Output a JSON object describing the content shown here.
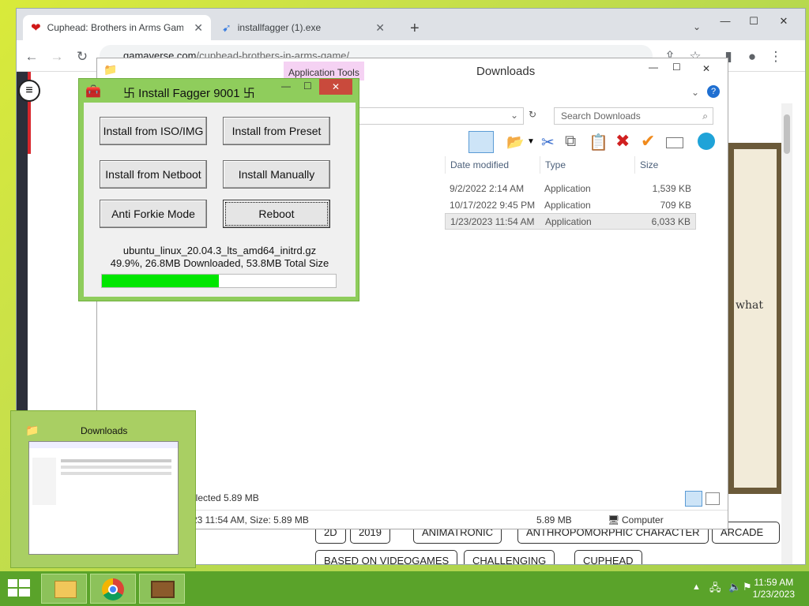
{
  "browser": {
    "tabs": [
      {
        "label": "Cuphead: Brothers in Arms Game"
      },
      {
        "label": "installfagger (1).exe"
      }
    ],
    "new_tab": "+",
    "url_domain": "gamaverse.com",
    "url_path": "/cuphead-brothers-in-arms-game/"
  },
  "page": {
    "art_text": "what",
    "tags_row1": [
      "2D",
      "2019",
      "ANIMATRONIC",
      "ANTHROPOMORPHIC CHARACTER",
      "ARCADE"
    ],
    "tags_row2": [
      "BASED ON VIDEOGAMES",
      "CHALLENGING",
      "CUPHEAD"
    ]
  },
  "explorer": {
    "title": "Downloads",
    "ribbon_tab": "Application Tools",
    "search_placeholder": "Search Downloads",
    "columns": {
      "date": "Date modified",
      "type": "Type",
      "size": "Size"
    },
    "files": [
      {
        "date": "9/2/2022 2:14 AM",
        "type": "Application",
        "size": "1,539 KB"
      },
      {
        "date": "10/17/2022 9:45 PM",
        "type": "Application",
        "size": "709 KB"
      },
      {
        "date": "1/23/2023 11:54 AM",
        "type": "Application",
        "size": "6,033 KB"
      }
    ],
    "status_selected": "elected  5.89 MB",
    "details_left": "23 11:54 AM, Size: 5.89 MB",
    "details_size": "5.89 MB",
    "details_location": "Computer"
  },
  "installer": {
    "title": "卐 Install Fagger 9001 卐",
    "buttons": {
      "iso": "Install from ISO/IMG",
      "preset": "Install from Preset",
      "netboot": "Install from Netboot",
      "manual": "Install Manually",
      "forkie": "Anti Forkie Mode",
      "reboot": "Reboot"
    },
    "filename": "ubuntu_linux_20.04.3_lts_amd64_initrd.gz",
    "progress_text": "49.9%, 26.8MB Downloaded, 53.8MB Total Size",
    "progress_fraction": 0.499
  },
  "thumbnail": {
    "title": "Downloads"
  },
  "taskbar": {
    "time": "11:59 AM",
    "date": "1/23/2023"
  }
}
